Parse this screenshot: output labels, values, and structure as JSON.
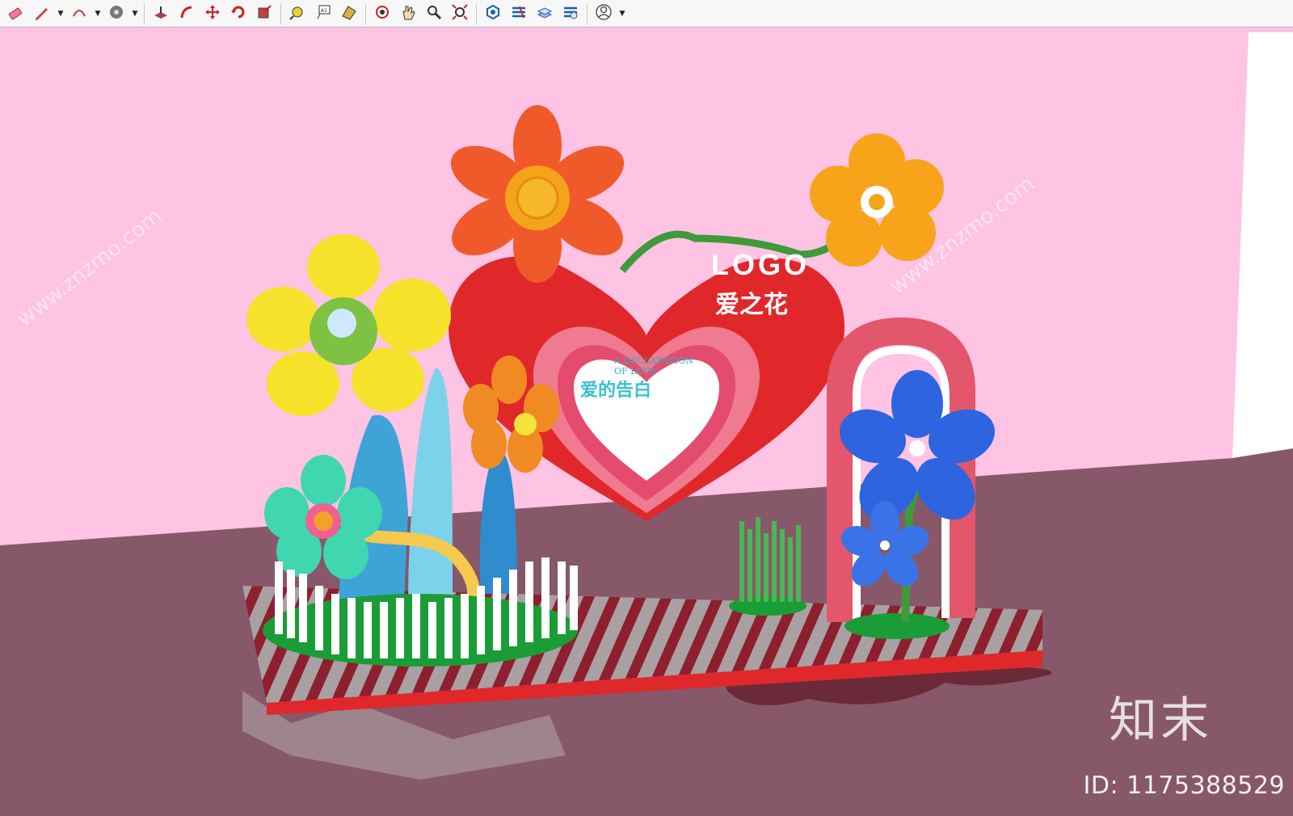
{
  "toolbar": {
    "tools": [
      {
        "name": "eraser-tool-icon"
      },
      {
        "name": "pencil-tool-icon",
        "dropdown": true
      },
      {
        "name": "arc-tool-icon",
        "dropdown": true
      },
      {
        "name": "paint-bucket-icon",
        "dropdown": true
      },
      {
        "name": "push-pull-icon"
      },
      {
        "name": "follow-me-icon"
      },
      {
        "name": "move-tool-icon"
      },
      {
        "name": "rotate-tool-icon"
      },
      {
        "name": "scale-tool-icon"
      },
      {
        "name": "tape-measure-icon"
      },
      {
        "name": "text-tool-icon"
      },
      {
        "name": "section-plane-icon"
      },
      {
        "name": "orbit-tool-icon"
      },
      {
        "name": "pan-tool-icon"
      },
      {
        "name": "zoom-tool-icon"
      },
      {
        "name": "zoom-extents-icon"
      },
      {
        "name": "warehouse-icon"
      },
      {
        "name": "extension-warehouse-icon"
      },
      {
        "name": "layout-send-icon"
      },
      {
        "name": "extension-manager-icon"
      },
      {
        "name": "user-account-icon",
        "dropdown": true
      }
    ]
  },
  "scene": {
    "logo": "LOGO",
    "title_cn": "爱之花",
    "love_en_line1": "A DECLARATION",
    "love_en_line2": "OF LOVE",
    "love_cn": "爱的告白",
    "colors": {
      "wall": "#ffc3e3",
      "floor": "#865869",
      "heart": "#e0282b",
      "platform_red": "#e0282b",
      "stripe_grey": "#a9a0a3"
    }
  },
  "watermark": {
    "brand": "知末",
    "id_text": "ID: 1175388529",
    "site": "www.znzmo.com"
  }
}
